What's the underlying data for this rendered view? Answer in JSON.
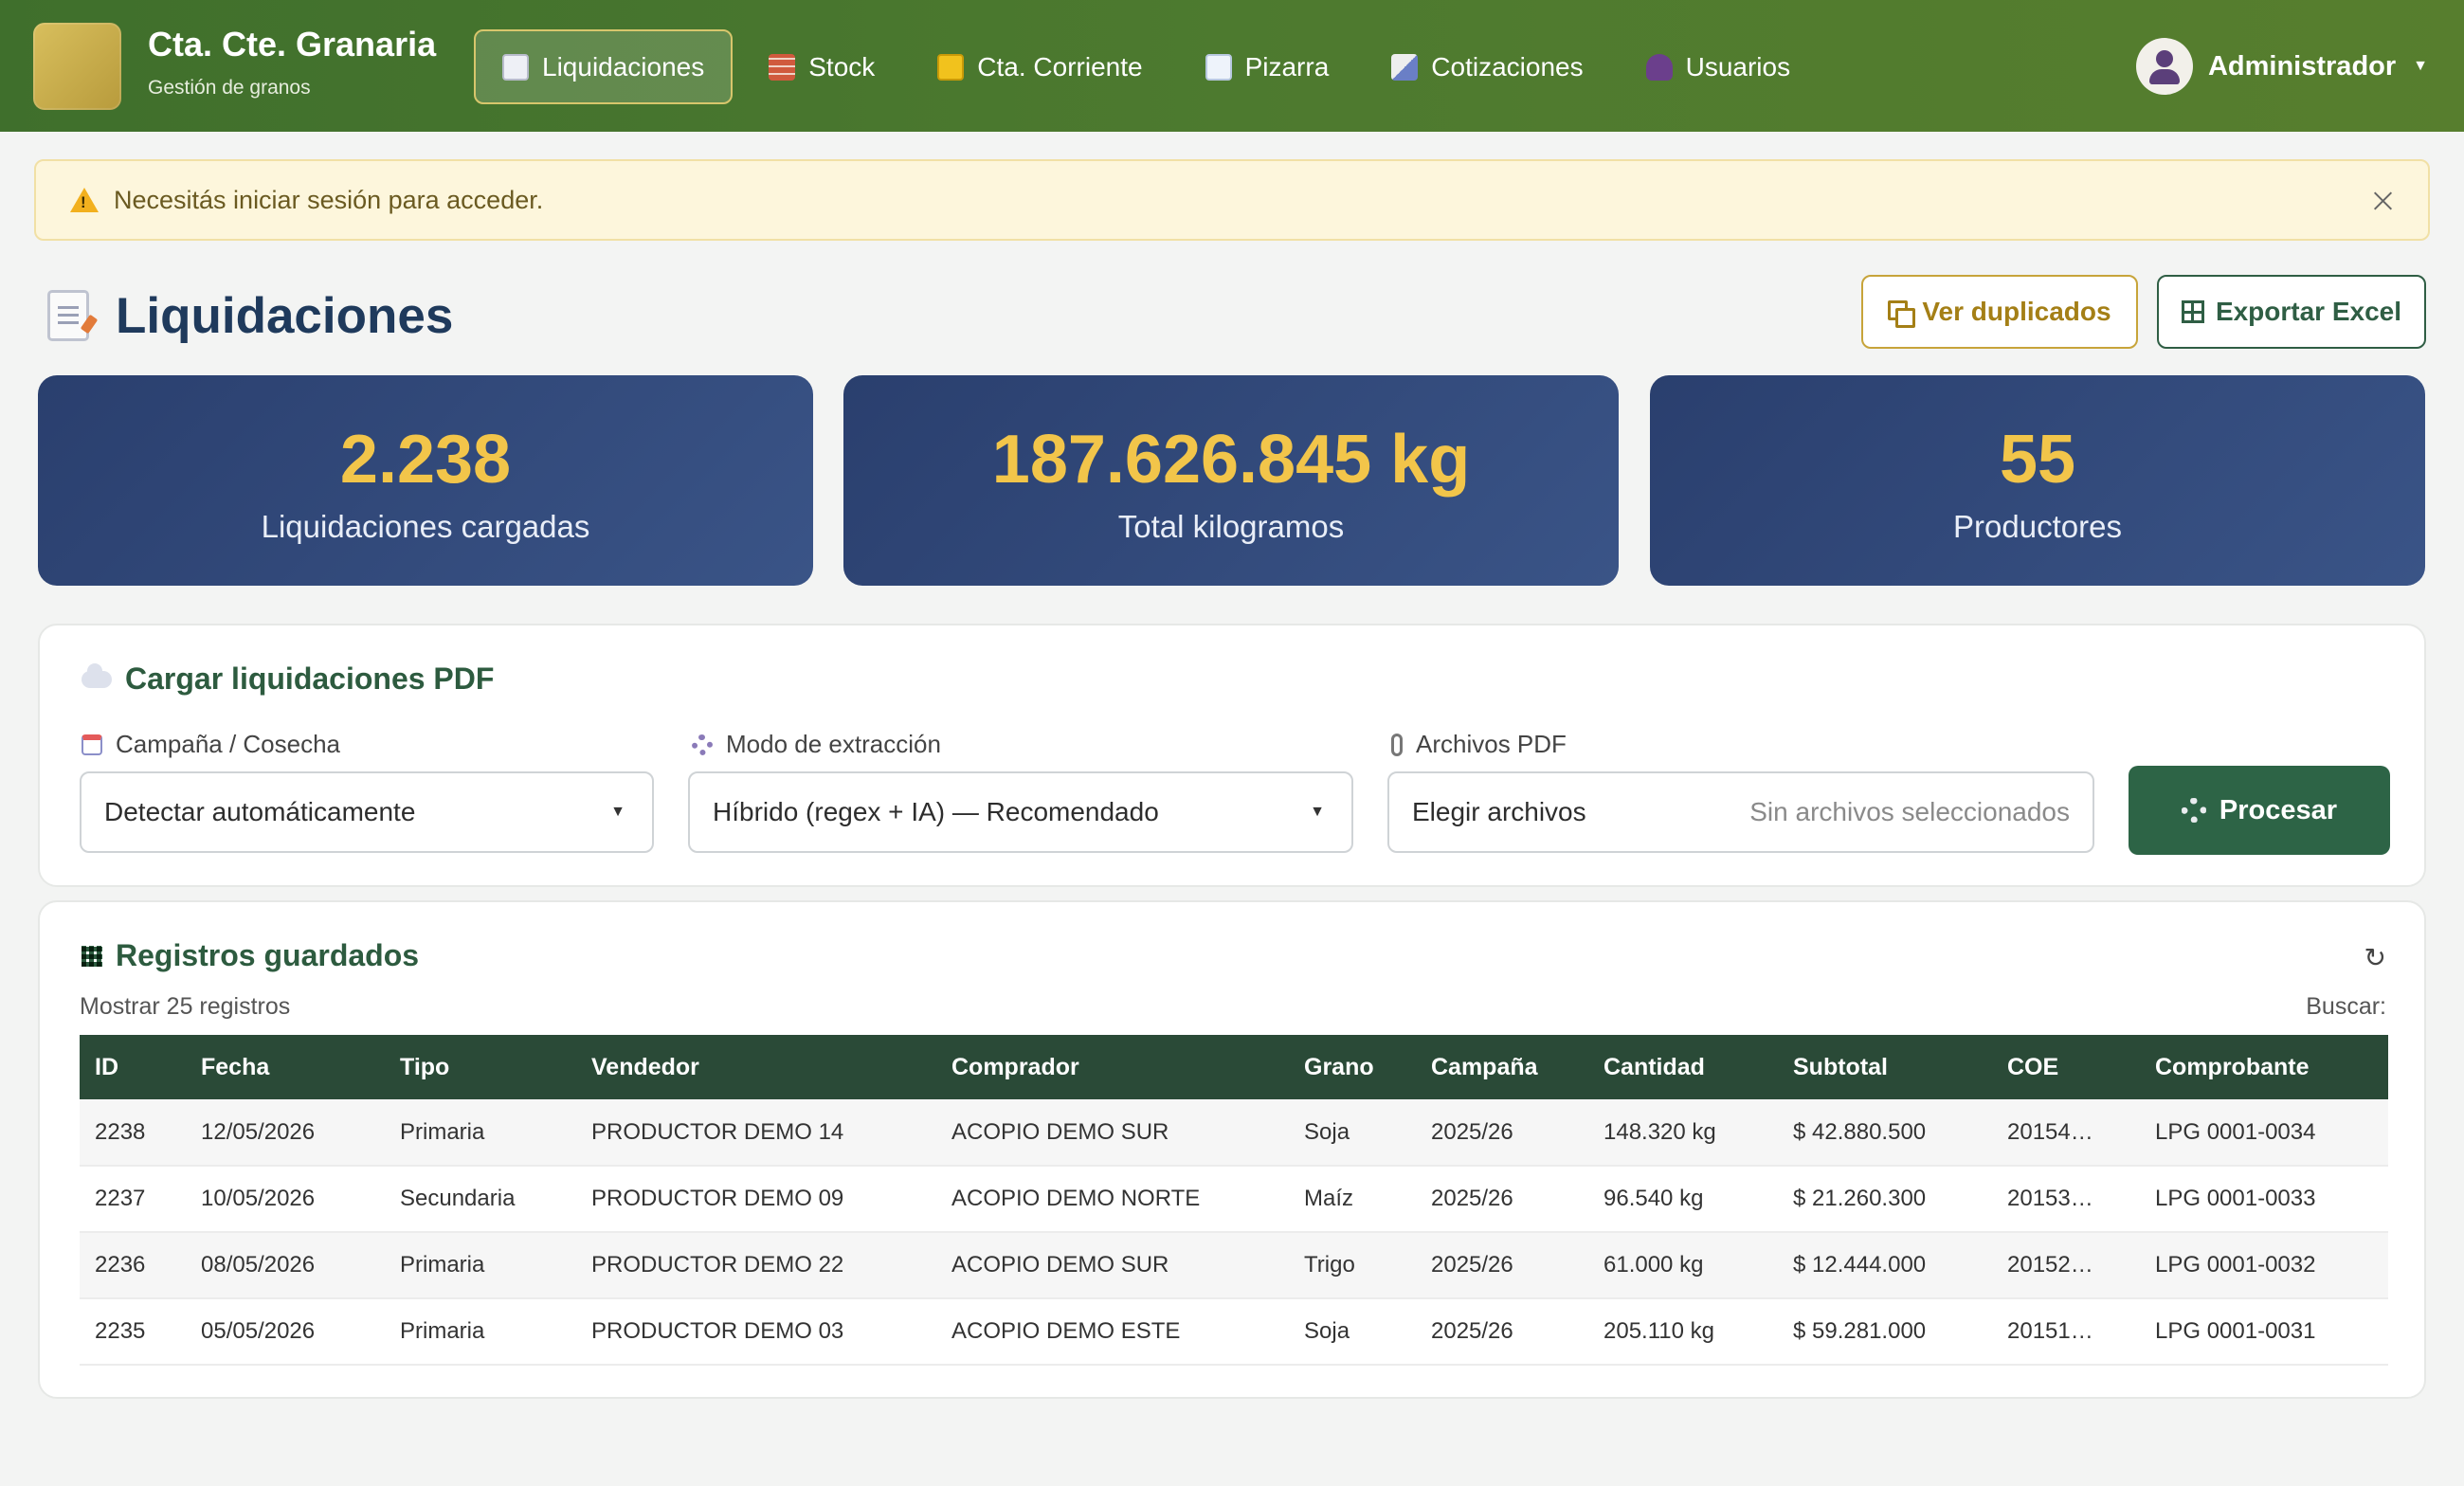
{
  "brand": {
    "title": "Cta. Cte. Granaria",
    "subtitle": "Gestión de granos"
  },
  "nav": [
    {
      "label": "Liquidaciones",
      "icon": "document-icon",
      "active": true
    },
    {
      "label": "Stock",
      "icon": "brick-icon"
    },
    {
      "label": "Cta. Corriente",
      "icon": "notebook-icon"
    },
    {
      "label": "Pizarra",
      "icon": "chart-icon"
    },
    {
      "label": "Cotizaciones",
      "icon": "brush-icon"
    },
    {
      "label": "Usuarios",
      "icon": "users-icon"
    }
  ],
  "user": {
    "name": "Administrador"
  },
  "alert": {
    "message": "Necesitás iniciar sesión para acceder."
  },
  "page": {
    "title": "Liquidaciones"
  },
  "actions": {
    "duplicates": "Ver duplicados",
    "export": "Exportar Excel"
  },
  "stats": [
    {
      "value": "2.238",
      "label": "Liquidaciones cargadas"
    },
    {
      "value": "187.626.845 kg",
      "label": "Total kilogramos"
    },
    {
      "value": "55",
      "label": "Productores"
    }
  ],
  "upload": {
    "title": "Cargar liquidaciones PDF",
    "campaign_label": "Campaña / Cosecha",
    "campaign_value": "Detectar automáticamente",
    "mode_label": "Modo de extracción",
    "mode_value": "Híbrido (regex + IA) — Recomendado",
    "files_label": "Archivos PDF",
    "files_button": "Elegir archivos",
    "files_hint": "Sin archivos seleccionados",
    "process_button": "Procesar"
  },
  "records": {
    "title": "Registros guardados",
    "show_label": "Mostrar 25 registros",
    "search_label": "Buscar:",
    "columns": [
      "ID",
      "Fecha",
      "Tipo",
      "Vendedor",
      "Comprador",
      "Grano",
      "Campaña",
      "Cantidad",
      "Subtotal",
      "COE",
      "Comprobante"
    ],
    "rows": [
      [
        "2238",
        "12/05/2026",
        "Primaria",
        "PRODUCTOR DEMO 14",
        "ACOPIO DEMO SUR",
        "Soja",
        "2025/26",
        "148.320 kg",
        "$ 42.880.500",
        "20154…",
        "LPG 0001-0034"
      ],
      [
        "2237",
        "10/05/2026",
        "Secundaria",
        "PRODUCTOR DEMO 09",
        "ACOPIO DEMO NORTE",
        "Maíz",
        "2025/26",
        "96.540 kg",
        "$ 21.260.300",
        "20153…",
        "LPG 0001-0033"
      ],
      [
        "2236",
        "08/05/2026",
        "Primaria",
        "PRODUCTOR DEMO 22",
        "ACOPIO DEMO SUR",
        "Trigo",
        "2025/26",
        "61.000 kg",
        "$ 12.444.000",
        "20152…",
        "LPG 0001-0032"
      ],
      [
        "2235",
        "05/05/2026",
        "Primaria",
        "PRODUCTOR DEMO 03",
        "ACOPIO DEMO ESTE",
        "Soja",
        "2025/26",
        "205.110 kg",
        "$ 59.281.000",
        "20151…",
        "LPG 0001-0031"
      ]
    ]
  },
  "colors": {
    "header_green": "#4d7a2f",
    "stat_navy": "#2a3f6e",
    "stat_gold": "#f2c54a",
    "primary_green": "#2d6446",
    "table_header": "#2a4a37",
    "alert_bg": "#fdf6dc"
  }
}
